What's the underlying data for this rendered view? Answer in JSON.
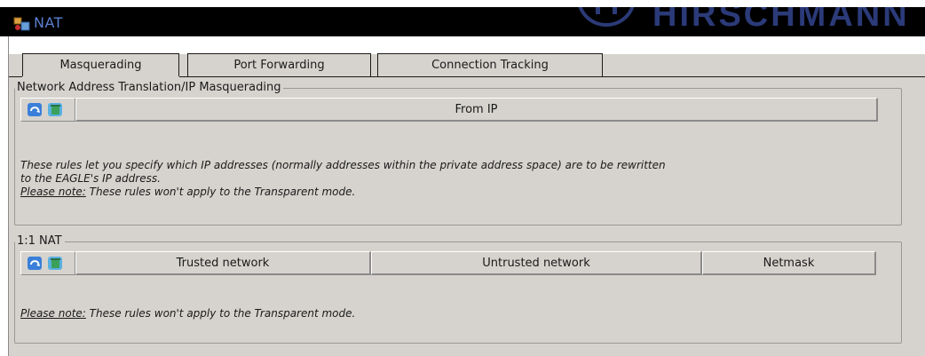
{
  "window": {
    "title": "NAT",
    "brand": "HIRSCHMANN"
  },
  "tabs": [
    {
      "label": "Masquerading",
      "active": true
    },
    {
      "label": "Port Forwarding",
      "active": false
    },
    {
      "label": "Connection Tracking",
      "active": false
    }
  ],
  "masquerading": {
    "legend": "Network Address Translation/IP Masquerading",
    "columns": [
      "From IP"
    ],
    "description_line1": "These rules let you specify which IP addresses (normally addresses within the private address space) are to be rewritten",
    "description_line2": "to the EAGLE's IP address.",
    "note_prefix": "Please note:",
    "note_text": " These rules won't apply to the Transparent mode."
  },
  "one_to_one_nat": {
    "legend": "1:1 NAT",
    "columns": [
      "Trusted network",
      "Untrusted network",
      "Netmask"
    ],
    "note_prefix": "Please note:",
    "note_text": " These rules won't apply to the Transparent mode."
  },
  "icons": {
    "app": "nat-app-icon",
    "add_row": "add-row-icon",
    "delete_row": "delete-row-icon",
    "brand_logo": "hirschmann-logo-icon"
  },
  "colors": {
    "titlebar": "#000000",
    "title_text": "#5a7fd0",
    "panel": "#d6d3ce",
    "icon_blue": "#3a7fd9",
    "icon_green": "#3aa05a"
  }
}
